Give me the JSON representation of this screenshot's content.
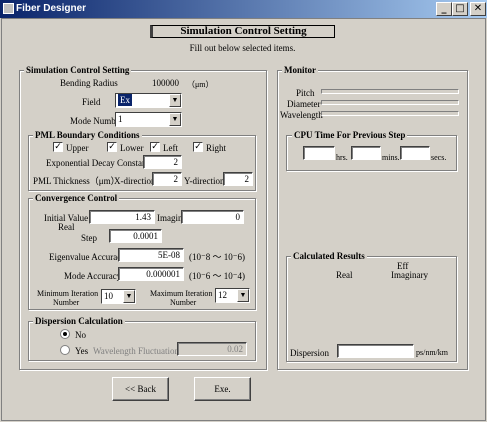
{
  "window": {
    "title": "Fiber Designer",
    "min": "_",
    "max": "□",
    "close": "✕"
  },
  "header": {
    "title": "Simulation Control Setting",
    "subtitle": "Fill out below selected items."
  },
  "sim": {
    "legend": "Simulation Control Setting",
    "bending_label": "Bending Radius",
    "bending_value": "100000",
    "bending_unit": "（μm）",
    "field_label": "Field",
    "field_value": "Ex",
    "mode_label": "Mode Number",
    "mode_value": "1"
  },
  "pml": {
    "legend": "PML Boundary Conditions",
    "upper": "Upper",
    "lower": "Lower",
    "left": "Left",
    "right": "Right",
    "decay_label": "Exponential Decay Constant",
    "decay_value": "2",
    "thickness_label": "PML Thickness（μm）",
    "xdir_label": "X-direction",
    "xdir_value": "2",
    "ydir_label": "Y-direction",
    "ydir_value": "2"
  },
  "conv": {
    "legend": "Convergence Control",
    "initial_label": "Initial Value",
    "real_label": "Real",
    "initial_real": "1.43",
    "imag_label": "Imagin",
    "initial_imag": "0",
    "step_label": "Step",
    "step_value": "0.0001",
    "eig_label": "Eigenvalue Accuracy",
    "eig_value": "5E-08",
    "eig_range": "(10⁻8 ～ 10⁻6)",
    "mode_label": "Mode Accuracy",
    "mode_value": "0.000001",
    "mode_range": "(10⁻6 ～ 10⁻4)",
    "min_iter_label1": "Minimum Iteration",
    "min_iter_label2": "Number",
    "min_iter_value": "10",
    "max_iter_label1": "Maximum Iteration",
    "max_iter_label2": "Number",
    "max_iter_value": "12"
  },
  "disp": {
    "legend": "Dispersion Calculation",
    "no_label": "No",
    "yes_label": "Yes",
    "wl_label": "Wavelength Fluctuation",
    "wl_value": "0.02"
  },
  "buttons": {
    "back": "<< Back",
    "exe": "Exe."
  },
  "monitor": {
    "legend": "Monitor",
    "pitch": "Pitch",
    "diameter": "Diameter",
    "wavelength": "Wavelength"
  },
  "cpu": {
    "legend": "CPU Time For Previous Step",
    "hrs": "hrs.",
    "mins": "mins.",
    "secs": "secs.",
    "hrs_value": "",
    "mins_value": "",
    "secs_value": ""
  },
  "results": {
    "legend": "Calculated Results",
    "eff_label": "Eff",
    "real_label": "Real",
    "imag_label": "Imaginary",
    "dispersion_label": "Dispersion",
    "dispersion_value": "",
    "dispersion_unit": "ps/nm/km"
  }
}
